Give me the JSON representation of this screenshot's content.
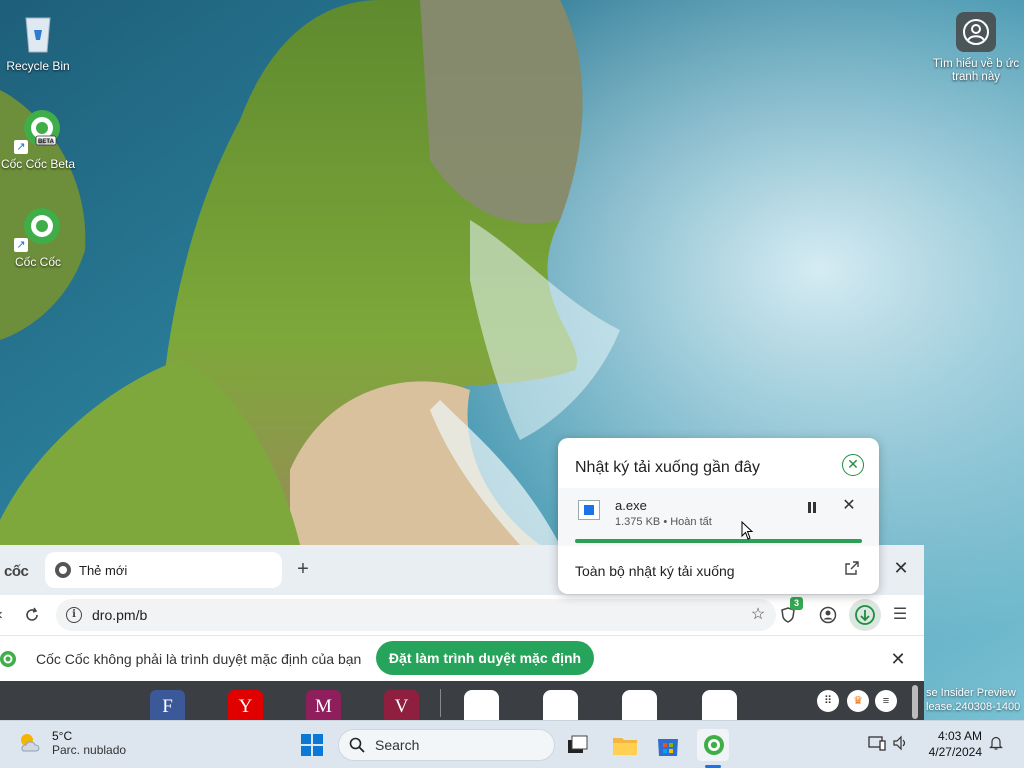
{
  "desktop": {
    "icons": [
      {
        "label": "Recycle Bin",
        "icon": "recycle-bin-icon"
      },
      {
        "label": "Cốc Cốc Beta",
        "icon": "coccoc-beta-icon",
        "badge": "BETA"
      },
      {
        "label": "Cốc Cốc",
        "icon": "coccoc-icon"
      }
    ],
    "right_icon": {
      "label": "Tìm hiểu về b ức tranh này",
      "icon": "learn-about-picture-icon"
    }
  },
  "browser": {
    "brand": "cốc",
    "tab": {
      "title": "Thẻ mới"
    },
    "new_tab": "+",
    "close": "✕",
    "toolbar": {
      "url": "dro.pm/b",
      "shield_badge": "3"
    },
    "infobar": {
      "message": "Cốc Cốc không phải là trình duyệt mặc định của bạn",
      "button": "Đặt làm trình duyệt mặc định",
      "close": "✕"
    },
    "shortcuts": [
      {
        "letter": "F",
        "color": "#3b5998"
      },
      {
        "letter": "Y",
        "color": "#e00000"
      },
      {
        "letter": "M",
        "color": "#8e1f5c"
      },
      {
        "letter": "V",
        "color": "#8e1f3f"
      }
    ]
  },
  "download_popup": {
    "title": "Nhật ký tải xuống gần đây",
    "item": {
      "name": "a.exe",
      "status": "1.375 KB • Hoàn tất",
      "progress": 1.0
    },
    "all_downloads": "Toàn bộ nhật ký tải xuống"
  },
  "watermark": {
    "line1": "se Insider Preview",
    "line2": "lease.240308-1400"
  },
  "taskbar": {
    "weather": {
      "temp": "5°C",
      "desc": "Parc. nublado"
    },
    "search_placeholder": "Search",
    "clock": {
      "time": "4:03 AM",
      "date": "4/27/2024"
    }
  },
  "colors": {
    "accent_green": "#27a45b",
    "download_green": "#2e9e57",
    "taskbar": "#dde6ee"
  }
}
